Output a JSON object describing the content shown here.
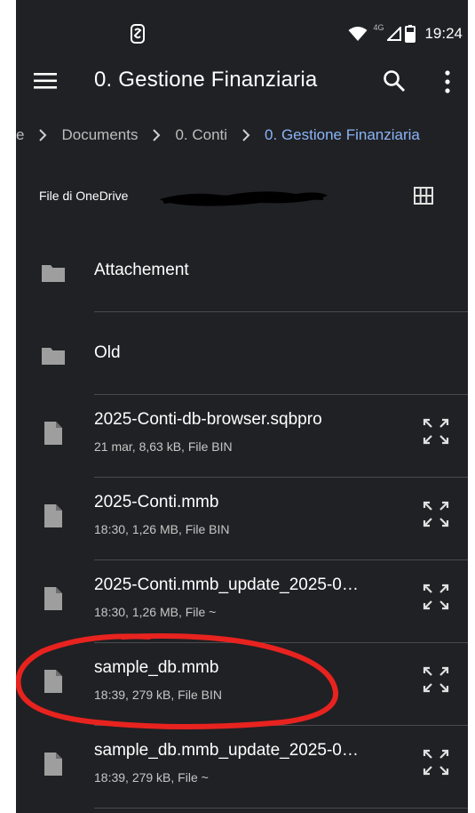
{
  "status_bar": {
    "time": "19:24",
    "network": "4G",
    "icons": [
      "app-notification-icon",
      "wifi-icon",
      "signal-icon",
      "battery-icon"
    ]
  },
  "app_bar": {
    "title": "0. Gestione Finanziaria",
    "icons": [
      "menu-icon",
      "search-icon",
      "more-vert-icon"
    ]
  },
  "breadcrumb": {
    "items": [
      {
        "label": "e"
      },
      {
        "label": "Documents"
      },
      {
        "label": "0. Conti"
      },
      {
        "label": "0. Gestione Finanziaria",
        "active": true
      }
    ]
  },
  "account": {
    "label": "File di OneDrive",
    "view_toggle_icon": "grid-view-icon"
  },
  "items": [
    {
      "type": "folder",
      "name": "Attachement",
      "icon": "folder-icon"
    },
    {
      "type": "folder",
      "name": "Old",
      "icon": "folder-icon"
    },
    {
      "type": "file",
      "name": "2025-Conti-db-browser.sqbpro",
      "meta": "21 mar, 8,63 kB, File BIN",
      "icon": "file-icon"
    },
    {
      "type": "file",
      "name": "2025-Conti.mmb",
      "meta": "18:30, 1,26 MB, File BIN",
      "icon": "file-icon"
    },
    {
      "type": "file",
      "name": "2025-Conti.mmb_update_2025-0…",
      "meta": "18:30, 1,26 MB, File ~",
      "icon": "file-icon"
    },
    {
      "type": "file",
      "name": "sample_db.mmb",
      "meta": "18:39, 279 kB, File BIN",
      "icon": "file-icon",
      "highlighted": true
    },
    {
      "type": "file",
      "name": "sample_db.mmb_update_2025-0…",
      "meta": "18:39, 279 kB, File ~",
      "icon": "file-icon"
    }
  ],
  "colors": {
    "background": "#202124",
    "text_primary": "#ffffff",
    "text_secondary": "#c6c6c6",
    "breadcrumb_active": "#8ab4f8",
    "icon": "#9e9e9e",
    "annotation": "#e8231f"
  }
}
